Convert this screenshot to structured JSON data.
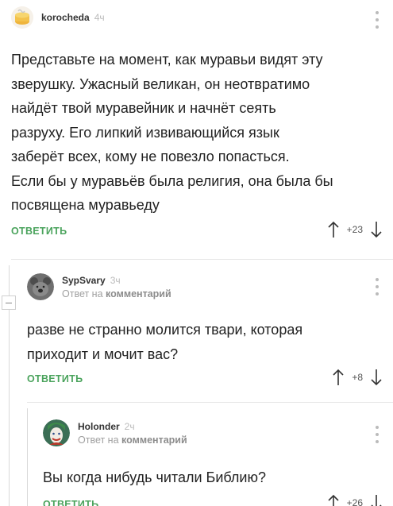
{
  "comments": [
    {
      "username": "korocheda",
      "time": "4ч",
      "text": [
        "Представьте на момент, как муравьи видят эту",
        "зверушку. Ужасный великан, он неотвратимо",
        "найдёт твой муравейник и начнёт сеять",
        "разруху. Его липкий извивающийся язык",
        "заберёт всех, кому не повезло попасться.",
        "Если бы у муравьёв была религия, она была бы",
        "посвящена муравьеду"
      ],
      "reply_label": "ОТВЕТИТЬ",
      "score": "+23"
    },
    {
      "username": "SypSvary",
      "time": "3ч",
      "reply_to_prefix": "Ответ на",
      "reply_to_target": "комментарий",
      "text": [
        "разве не странно молится твари, которая",
        "приходит и мочит вас?"
      ],
      "reply_label": "ОТВЕТИТЬ",
      "score": "+8"
    },
    {
      "username": "Holonder",
      "time": "2ч",
      "reply_to_prefix": "Ответ на",
      "reply_to_target": "комментарий",
      "text": [
        "Вы когда нибудь читали Библию?"
      ],
      "reply_label": "ОТВЕТИТЬ",
      "score": "+26"
    }
  ],
  "icons": {
    "upvote": "arrow-up-icon",
    "downvote": "arrow-down-icon",
    "more": "kebab-menu-icon",
    "collapse": "collapse-thread-icon"
  },
  "colors": {
    "reply_green": "#4aa35c",
    "muted": "#a0a0a0"
  }
}
